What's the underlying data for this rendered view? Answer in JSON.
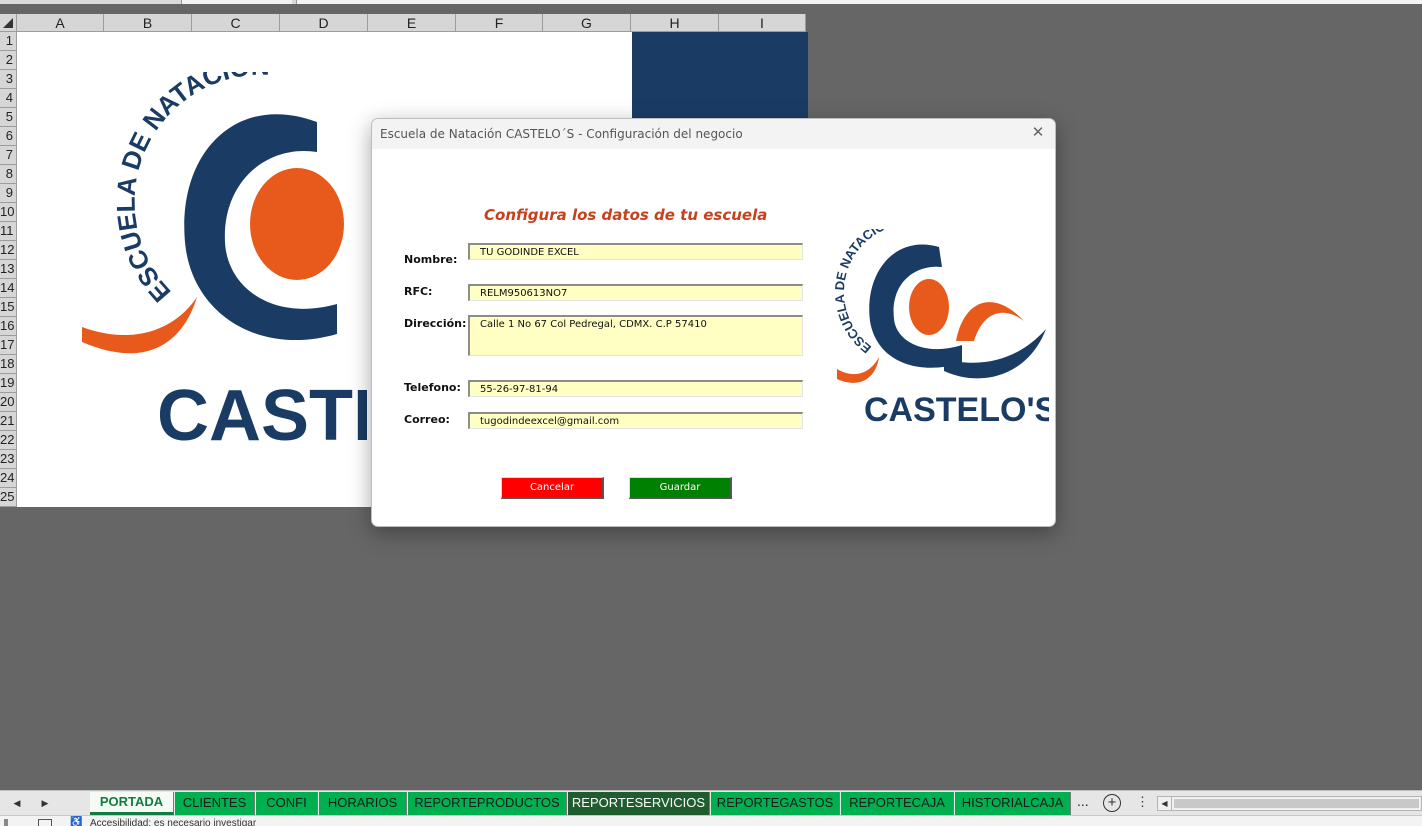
{
  "app": {
    "columns": [
      "A",
      "B",
      "C",
      "D",
      "E",
      "F",
      "G",
      "H",
      "I"
    ],
    "rows": [
      "1",
      "2",
      "3",
      "4",
      "5",
      "6",
      "7",
      "8",
      "9",
      "10",
      "11",
      "12",
      "13",
      "14",
      "15",
      "16",
      "17",
      "18",
      "19",
      "20",
      "21",
      "22",
      "23",
      "24",
      "25"
    ]
  },
  "sheet": {
    "logo_arc_text": "ESCUELA DE NATACIÓN",
    "logo_name": "CASTELO'S"
  },
  "dialog": {
    "title": "Escuela de Natación CASTELO´S - Configuración del negocio",
    "close_symbol": "✕",
    "heading": "Configura los datos de tu escuela",
    "fields": {
      "nombre": {
        "label": "Nombre:",
        "value": "TU GODINDE EXCEL"
      },
      "rfc": {
        "label": "RFC:",
        "value": "RELM950613NO7"
      },
      "direccion": {
        "label": "Dirección:",
        "value": "Calle 1 No 67 Col Pedregal, CDMX. C.P 57410"
      },
      "telefono": {
        "label": "Telefono:",
        "value": "55-26-97-81-94"
      },
      "correo": {
        "label": "Correo:",
        "value": "tugodindeexcel@gmail.com"
      }
    },
    "cancel_label": "Cancelar",
    "save_label": "Guardar",
    "logo_arc_text": "ESCUELA DE NATACIÓN",
    "logo_name": "CASTELO'S"
  },
  "tabs": {
    "prev_symbol": "◀",
    "next_symbol": "▶",
    "items": [
      {
        "label": "PORTADA",
        "state": "active"
      },
      {
        "label": "CLIENTES",
        "state": "normal"
      },
      {
        "label": "CONFI",
        "state": "normal"
      },
      {
        "label": "HORARIOS",
        "state": "normal"
      },
      {
        "label": "REPORTEPRODUCTOS",
        "state": "normal"
      },
      {
        "label": "REPORTESERVICIOS",
        "state": "dark"
      },
      {
        "label": "REPORTEGASTOS",
        "state": "normal"
      },
      {
        "label": "REPORTECAJA",
        "state": "normal"
      },
      {
        "label": "HISTORIALCAJA",
        "state": "normal"
      }
    ],
    "more_label": "...",
    "add_symbol": "+",
    "kebab_symbol": "⋮",
    "scroll_left_symbol": "◀"
  },
  "status": {
    "text": "Accesibilidad: es necesario investigar"
  },
  "colors": {
    "brand_navy": "#1a3c64",
    "brand_orange": "#e85a1b",
    "tab_green": "#00b050",
    "heading_orange": "#c8411e"
  },
  "icons": {
    "close": "close-icon",
    "add_sheet": "add-sheet-icon",
    "more": "more-options-icon",
    "accessibility": "accessibility-icon"
  }
}
